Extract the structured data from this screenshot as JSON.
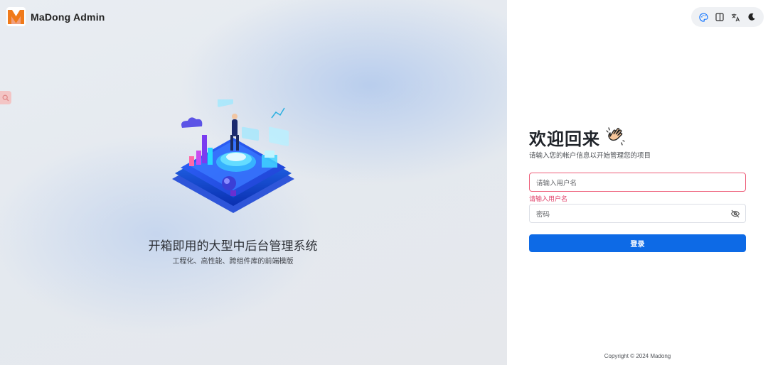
{
  "brand": {
    "name": "MaDong Admin",
    "logo_icon": "madong-logo-icon",
    "logo_color": "#f07a1a"
  },
  "hero": {
    "slogan": "开箱即用的大型中后台管理系统",
    "sub_slogan": "工程化、高性能、跨组件库的前端模版"
  },
  "toolbar": {
    "items": [
      {
        "name": "palette-icon",
        "color": "#1677ff"
      },
      {
        "name": "layout-icon"
      },
      {
        "name": "translate-icon"
      },
      {
        "name": "moon-icon"
      }
    ]
  },
  "login": {
    "title": "欢迎回来",
    "emoji": "👏",
    "subtitle": "请输入您的帐户信息以开始管理您的项目",
    "username": {
      "placeholder": "请输入用户名",
      "value": "",
      "error": "请输入用户名"
    },
    "password": {
      "placeholder": "密码",
      "value": ""
    },
    "submit_label": "登录"
  },
  "footer": {
    "copyright": "Copyright © 2024 Madong"
  },
  "colors": {
    "primary": "#0d6ae6",
    "error": "#e0436b",
    "panel_bg": "#e6eaf0"
  }
}
